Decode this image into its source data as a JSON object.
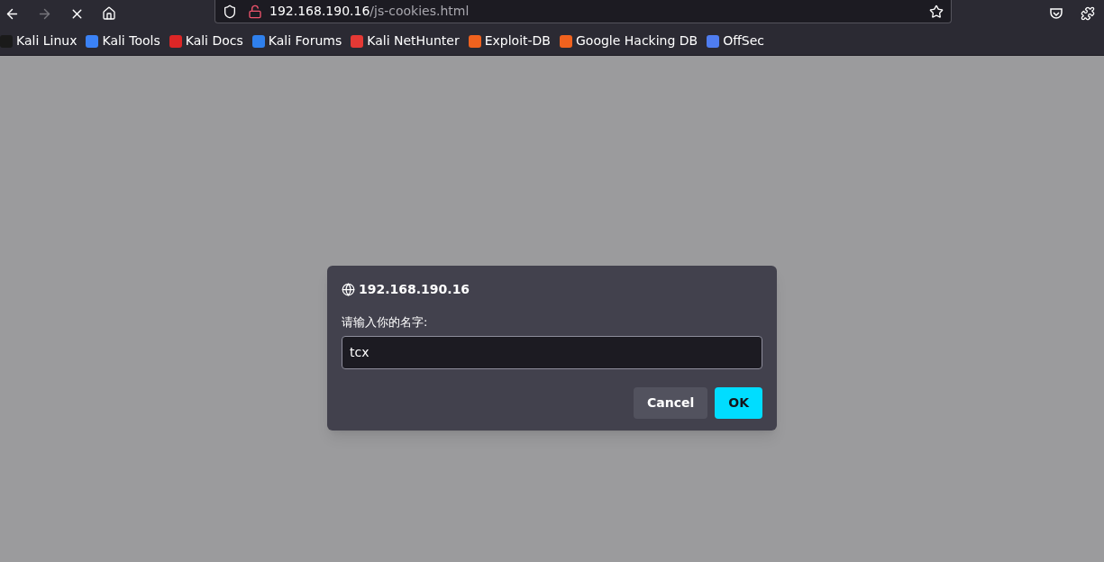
{
  "toolbar": {
    "back": {
      "disabled": false
    },
    "forward": {
      "disabled": true
    },
    "url_host": "192.168.190.16",
    "url_path": "/js-cookies.html"
  },
  "bookmarks": [
    {
      "label": "Kali Linux",
      "color": "#1a1a1a"
    },
    {
      "label": "Kali Tools",
      "color": "#3b82f6"
    },
    {
      "label": "Kali Docs",
      "color": "#dc2626"
    },
    {
      "label": "Kali Forums",
      "color": "#2f80ed"
    },
    {
      "label": "Kali NetHunter",
      "color": "#e53935"
    },
    {
      "label": "Exploit-DB",
      "color": "#f0621e"
    },
    {
      "label": "Google Hacking DB",
      "color": "#f0621e"
    },
    {
      "label": "OffSec",
      "color": "#4f7df0"
    }
  ],
  "dialog": {
    "origin": "192.168.190.16",
    "prompt": "请输入你的名字:",
    "value": "tcx",
    "buttons": [
      {
        "label": "Cancel",
        "kind": "secondary"
      },
      {
        "label": "OK",
        "kind": "primary"
      }
    ]
  }
}
